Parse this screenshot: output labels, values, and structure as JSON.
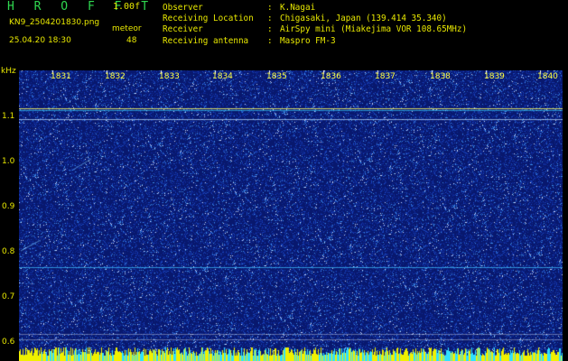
{
  "header": {
    "title": "H R O F F T",
    "version": "1.00f",
    "filename": "KN9_2504201830.png",
    "datetime": "25.04.20 18:30",
    "meteor_label": "meteor",
    "meteor_count": "48"
  },
  "info": {
    "rows": [
      {
        "key": "Observer",
        "value": "K.Nagai"
      },
      {
        "key": "Receiving Location",
        "value": "Chigasaki, Japan (139.414 35.340)"
      },
      {
        "key": "Receiver",
        "value": "AirSpy mini (Miakejima VOR 108.65MHz)"
      },
      {
        "key": "Receiving antenna",
        "value": "Maspro FM-3"
      }
    ]
  },
  "axis": {
    "y_unit": "kHz",
    "y_ticks": [
      "1.1",
      "1.0",
      "0.9",
      "0.8",
      "0.7",
      "0.6"
    ],
    "x_ticks": [
      "1831",
      "1832",
      "1833",
      "1834",
      "1835",
      "1836",
      "1837",
      "1838",
      "1839",
      "1840"
    ]
  },
  "colors": {
    "background": "#0a1e78",
    "text_yellow": "#e8e800",
    "title_green": "#2fd84f"
  }
}
